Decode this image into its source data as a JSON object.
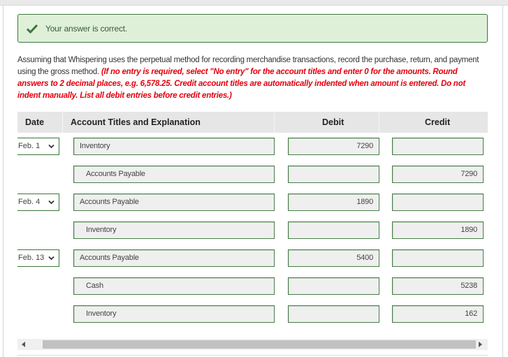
{
  "feedback": {
    "icon": "checkmark-icon",
    "message": "Your answer is correct.",
    "status_color": "#3c763d"
  },
  "question": {
    "text": "Assuming that Whispering uses the perpetual method for recording merchandise transactions, record the purchase, return, and payment using the gross method.",
    "instructions": "(If no entry is required, select \"No entry\" for the account titles and enter 0 for the amounts. Round answers to 2 decimal places, e.g. 6,578.25. Credit account titles are automatically indented when amount is entered. Do not indent manually. List all debit entries before credit entries.)",
    "instruction_color": "#e4000f"
  },
  "table": {
    "headers": {
      "date": "Date",
      "account": "Account Titles and Explanation",
      "debit": "Debit",
      "credit": "Credit"
    },
    "rows": [
      {
        "date": "Feb. 1",
        "account": "Inventory",
        "indent": false,
        "debit": "7290",
        "credit": ""
      },
      {
        "date": "",
        "account": "Accounts Payable",
        "indent": true,
        "debit": "",
        "credit": "7290"
      },
      {
        "date": "Feb. 4",
        "account": "Accounts Payable",
        "indent": false,
        "debit": "1890",
        "credit": ""
      },
      {
        "date": "",
        "account": "Inventory",
        "indent": true,
        "debit": "",
        "credit": "1890"
      },
      {
        "date": "Feb. 13",
        "account": "Accounts Payable",
        "indent": false,
        "debit": "5400",
        "credit": ""
      },
      {
        "date": "",
        "account": "Cash",
        "indent": true,
        "debit": "",
        "credit": "5238"
      },
      {
        "date": "",
        "account": "Inventory",
        "indent": true,
        "debit": "",
        "credit": "162"
      }
    ]
  },
  "scrollbar": {
    "left_arrow_icon": "arrow-left-icon",
    "right_arrow_icon": "arrow-right-icon"
  }
}
